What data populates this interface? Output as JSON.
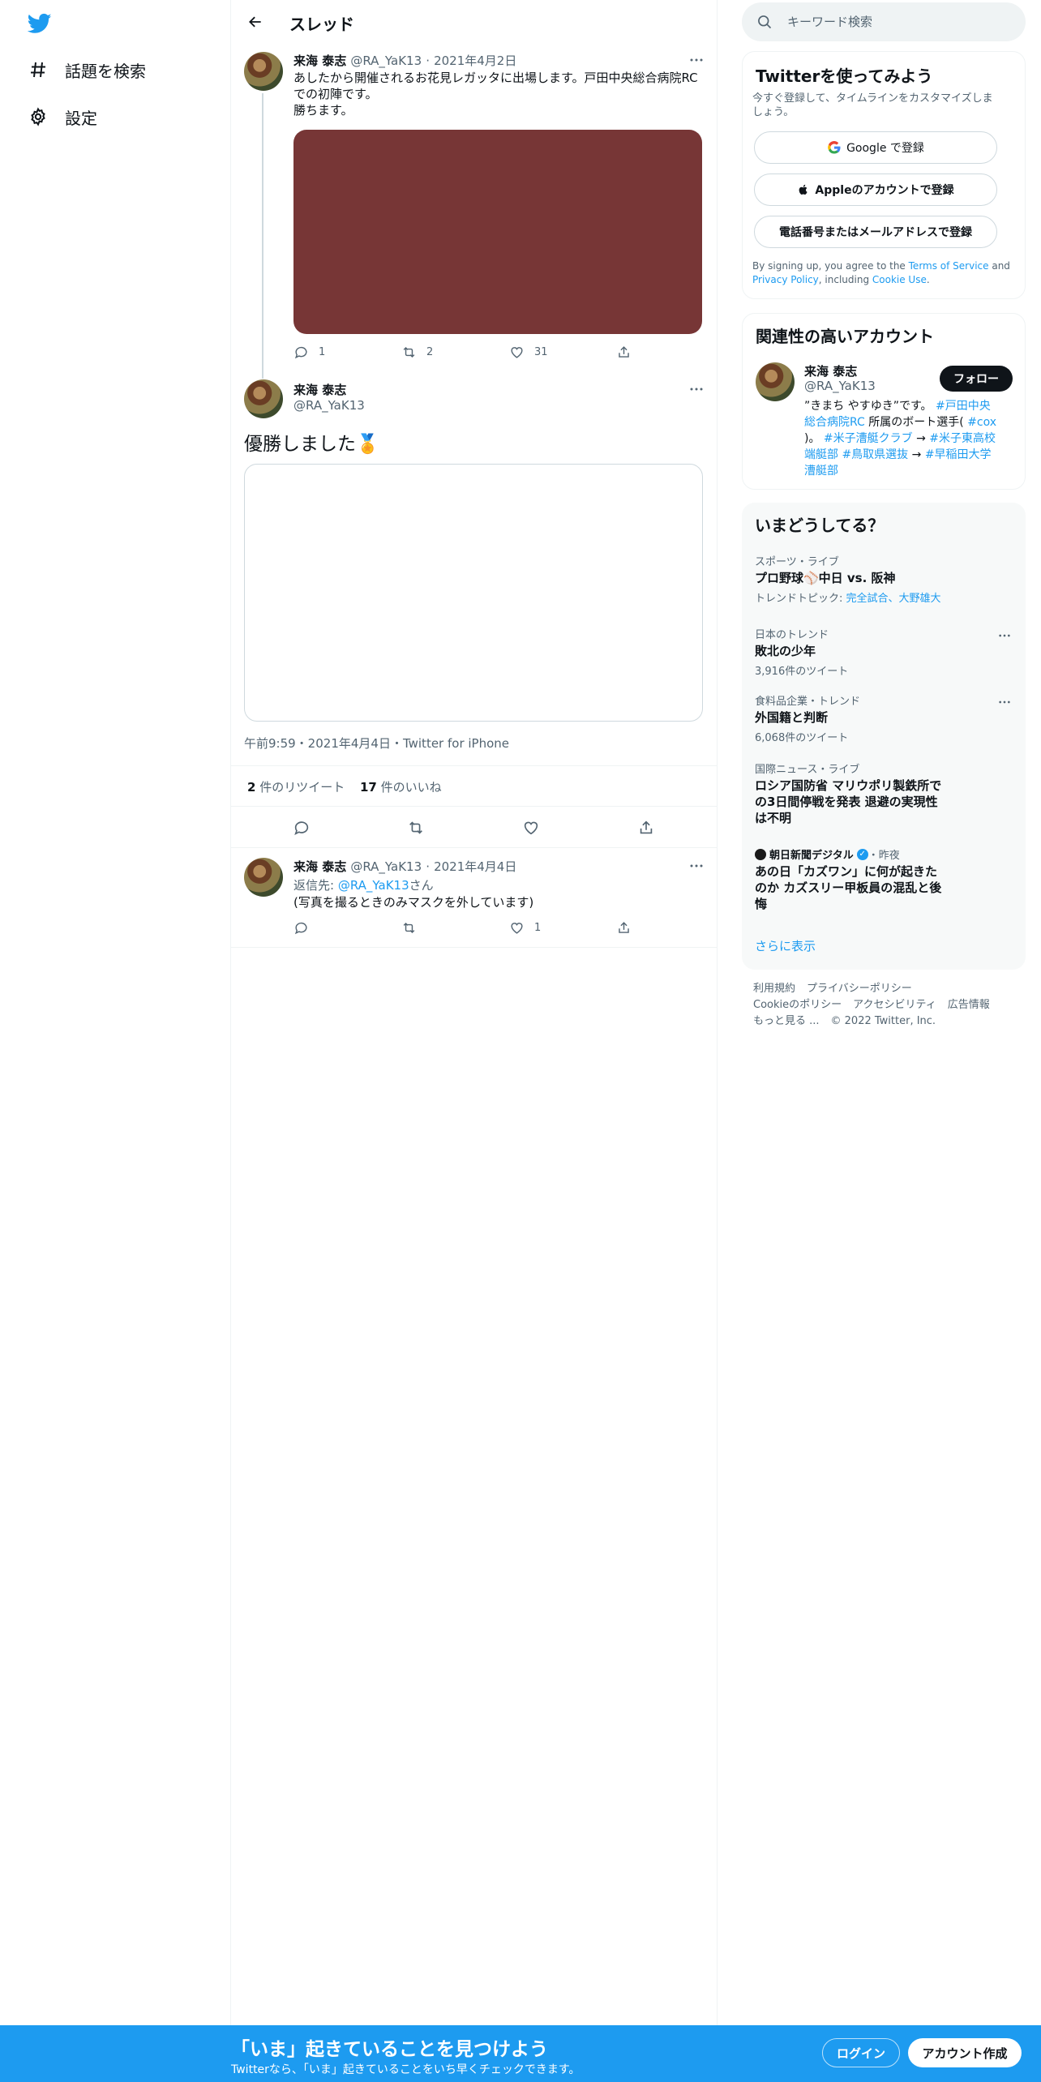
{
  "nav": {
    "items": [
      {
        "label": "話題を検索",
        "icon": "hashtag-icon"
      },
      {
        "label": "設定",
        "icon": "gear-icon"
      }
    ]
  },
  "header": {
    "title": "スレッド"
  },
  "tweet1": {
    "name": "来海 泰志",
    "handle": "@RA_YaK13",
    "date": "2021年4月2日",
    "lines": [
      "あしたから開催されるお花見レガッタに出場します。戸田中央総合病院RC",
      "での初陣です。",
      "勝ちます。"
    ],
    "media_color": "#773636",
    "replies": "1",
    "retweets": "2",
    "likes": "31"
  },
  "tweet2": {
    "name": "来海 泰志",
    "handle": "@RA_YaK13",
    "text": "優勝しました🏅",
    "timestamp": "午前9:59・2021年4月4日・Twitter for iPhone",
    "retweet_count": "2",
    "retweet_label": "件のリツイート",
    "like_count": "17",
    "like_label": "件のいいね"
  },
  "tweet3": {
    "name": "来海 泰志",
    "handle": "@RA_YaK13",
    "date": "2021年4月4日",
    "reply_prefix": "返信先: ",
    "reply_to": "@RA_YaK13",
    "reply_suffix": "さん",
    "text": "(写真を撮るときのみマスクを外しています)",
    "likes": "1"
  },
  "search": {
    "placeholder": "キーワード検索"
  },
  "signup_card": {
    "title": "Twitterを使ってみよう",
    "subtitle_lines": [
      "今すぐ登録して、タイムラインをカスタマイズしま",
      "しょう。"
    ],
    "google": "Google で登録",
    "apple": "Appleのアカウントで登録",
    "phone": "電話番号またはメールアドレスで登録",
    "terms_prefix": "By signing up, you agree to the ",
    "terms_link": "Terms of Service",
    "terms_and": " and",
    "privacy_link": "Privacy Policy",
    "terms_including": ", including ",
    "cookie_link": "Cookie Use",
    "terms_end": "."
  },
  "related": {
    "title": "関連性の高いアカウント",
    "name": "来海 泰志",
    "handle": "@RA_YaK13",
    "follow": "フォロー",
    "bio": {
      "l1a": "”きまち やすゆき”です。 ",
      "l1b": "#戸田中央",
      "l2a": "総合病院RC",
      "l2b": " 所属のボート選手( ",
      "l2c": "#cox",
      "l3a": ")。 ",
      "l3b": "#米子漕艇クラブ",
      "l3c": " → ",
      "l3d": "#米子東高校",
      "l4a": "端艇部",
      "l4b": " ",
      "l4c": "#鳥取県選抜",
      "l4d": " → ",
      "l4e": "#早稲田大学",
      "l5a": "漕艇部"
    }
  },
  "trends": {
    "title": "いまどうしてる？",
    "items": [
      {
        "category": "スポーツ・ライブ",
        "title": "プロ野球⚾中日 vs. 阪神",
        "sub_prefix": "トレンドトピック: ",
        "sub_link": "完全試合、大野雄大"
      },
      {
        "category": "日本のトレンド",
        "title": "敗北の少年",
        "sub": "3,916件のツイート"
      },
      {
        "category": "食料品企業・トレンド",
        "title": "外国籍と判断",
        "sub": "6,068件のツイート"
      },
      {
        "category": "国際ニュース・ライブ",
        "title_lines": [
          "ロシア国防省 マリウポリ製鉄所で",
          "の3日間停戦を発表 退避の実現性",
          "は不明"
        ]
      },
      {
        "category_name": "朝日新聞デジタル",
        "category_time": "・昨夜",
        "title_lines": [
          "あの日「カズワン」に何が起きた",
          "のか カズスリー甲板員の混乱と後",
          "悔"
        ]
      }
    ],
    "show_more": "さらに表示"
  },
  "footer": {
    "row1": [
      "利用規約",
      "プライバシーポリシー"
    ],
    "row2": [
      "Cookieのポリシー",
      "アクセシビリティ",
      "広告情報"
    ],
    "more": "もっと見る ...",
    "copyright": "© 2022 Twitter, Inc."
  },
  "bottombar": {
    "headline": "「いま」起きていることを見つけよう",
    "sub": "Twitterなら、「いま」起きていることをいち早くチェックできます。",
    "login": "ログイン",
    "signup": "アカウント作成"
  },
  "colors": {
    "accent": "#1d9bf0",
    "muted": "#536471",
    "media": "#773636"
  }
}
